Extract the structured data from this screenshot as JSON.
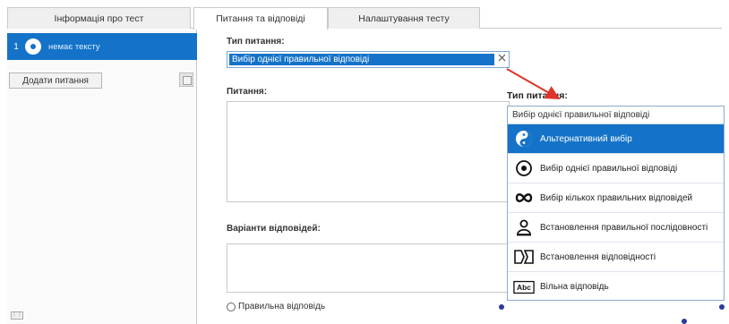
{
  "tabs": [
    {
      "label": "Інформація про тест"
    },
    {
      "label": "Питання та відповіді"
    },
    {
      "label": "Налаштування тесту"
    }
  ],
  "sidebar": {
    "question": {
      "number": "1",
      "text": "немає тексту"
    },
    "add_label": "Додати питання"
  },
  "form": {
    "type_label": "Тип питання:",
    "type_value": "Вибір однієї правильної відповіді",
    "question_label": "Питання:",
    "answers_label": "Варіанти відповідей:",
    "correct_label": "Правильна відповідь"
  },
  "popup": {
    "label": "Тип питання:",
    "header": "Вибір однієї правильної відповіді",
    "options": [
      {
        "label": "Альтернативний вибір",
        "icon": "yin-yang-icon",
        "selected": true
      },
      {
        "label": "Вибір однієї правильної відповіді",
        "icon": "radio-dot-icon",
        "selected": false
      },
      {
        "label": "Вибір кількох правильних відповідей",
        "icon": "infinity-icon",
        "selected": false
      },
      {
        "label": "Встановлення правильної послідовності",
        "icon": "person-sequence-icon",
        "selected": false
      },
      {
        "label": "Встановлення відповідності",
        "icon": "matching-icon",
        "selected": false
      },
      {
        "label": "Вільна відповідь",
        "icon": "abc-box-icon",
        "icon_text": "Abc",
        "selected": false
      }
    ]
  },
  "colors": {
    "accent": "#1473c8",
    "arrow": "#e0342a"
  }
}
